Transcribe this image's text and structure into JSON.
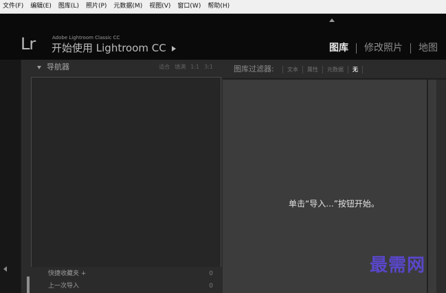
{
  "menu_bar": {
    "items": [
      "文件(F)",
      "编辑(E)",
      "图库(L)",
      "照片(P)",
      "元数据(M)",
      "视图(V)",
      "窗口(W)",
      "帮助(H)"
    ]
  },
  "identity_plate": {
    "logo": "Lr",
    "small": "Adobe Lightroom Classic CC",
    "main": "开始使用 Lightroom CC"
  },
  "modules": {
    "items": [
      "图库",
      "修改照片",
      "地图"
    ],
    "active": "图库"
  },
  "navigator": {
    "title": "导航器",
    "zoom_options": [
      "适合",
      "填满",
      "1:1",
      "3:1"
    ]
  },
  "catalog": {
    "rows": [
      {
        "label": "快捷收藏夹 +",
        "count": "0"
      },
      {
        "label": "上一次导入",
        "count": "0"
      }
    ]
  },
  "library_filter": {
    "title": "图库过滤器:",
    "tabs": [
      "文本",
      "属性",
      "元数据",
      "无"
    ],
    "active_tab": "无"
  },
  "grid": {
    "empty_message": "单击“导入...”按钮开始。"
  },
  "watermark": "最需网",
  "colors": {
    "menubar_bg": "#f0f0f0",
    "topbar_bg": "#0a0a0a",
    "panel_bg": "#2b2b2b",
    "grid_bg": "#3c3c3c",
    "watermark": "#5847c9"
  },
  "icons": [
    "collapse-up-icon",
    "expand-arrow-icon",
    "disclosure-triangle-icon",
    "collapse-left-icon"
  ]
}
